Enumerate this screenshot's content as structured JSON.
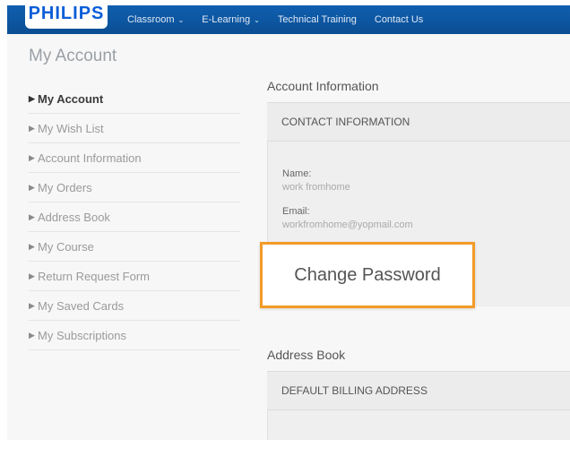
{
  "header": {
    "logo_text": "PHILIPS",
    "nav": [
      {
        "label": "Classroom",
        "has_dropdown": true
      },
      {
        "label": "E-Learning",
        "has_dropdown": true
      },
      {
        "label": "Technical Training",
        "has_dropdown": false
      },
      {
        "label": "Contact Us",
        "has_dropdown": false
      }
    ]
  },
  "page": {
    "title": "My Account"
  },
  "sidebar": {
    "items": [
      {
        "label": "My Account",
        "active": true
      },
      {
        "label": "My Wish List"
      },
      {
        "label": "Account Information"
      },
      {
        "label": "My Orders"
      },
      {
        "label": "Address Book"
      },
      {
        "label": "My Course"
      },
      {
        "label": "Return Request Form"
      },
      {
        "label": "My Saved Cards"
      },
      {
        "label": "My Subscriptions"
      }
    ]
  },
  "account_info": {
    "title": "Account Information",
    "contact_header": "CONTACT INFORMATION",
    "name_label": "Name:",
    "name_value": "work fromhome",
    "email_label": "Email:",
    "email_value": "workfromhome@yopmail.com",
    "change_password_label": "Change Password"
  },
  "address_book": {
    "title": "Address Book",
    "billing_header": "DEFAULT BILLING ADDRESS"
  },
  "colors": {
    "nav_bg": "#0b5ed7",
    "highlight_border": "#f29b27"
  }
}
